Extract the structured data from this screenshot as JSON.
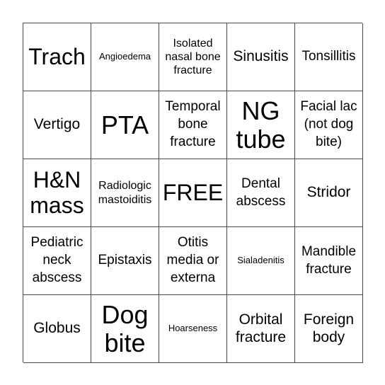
{
  "board": {
    "cells": [
      {
        "text": "Trach",
        "size": "xl"
      },
      {
        "text": "Angioedema",
        "size": "xs"
      },
      {
        "text": "Isolated nasal bone fracture",
        "size": "sm"
      },
      {
        "text": "Sinusitis",
        "size": "lg"
      },
      {
        "text": "Tonsillitis",
        "size": "md"
      },
      {
        "text": "Vertigo",
        "size": "lg"
      },
      {
        "text": "PTA",
        "size": "xxl"
      },
      {
        "text": "Temporal bone fracture",
        "size": "md"
      },
      {
        "text": "NG tube",
        "size": "xxl"
      },
      {
        "text": "Facial lac (not dog bite)",
        "size": "md"
      },
      {
        "text": "H&N mass",
        "size": "xl"
      },
      {
        "text": "Radiologic mastoiditis",
        "size": "sm"
      },
      {
        "text": "FREE",
        "size": "xl"
      },
      {
        "text": "Dental abscess",
        "size": "md"
      },
      {
        "text": "Stridor",
        "size": "lg"
      },
      {
        "text": "Pediatric neck abscess",
        "size": "md"
      },
      {
        "text": "Epistaxis",
        "size": "md"
      },
      {
        "text": "Otitis media or externa",
        "size": "md"
      },
      {
        "text": "Sialadenitis",
        "size": "xs"
      },
      {
        "text": "Mandible fracture",
        "size": "md"
      },
      {
        "text": "Globus",
        "size": "lg"
      },
      {
        "text": "Dog bite",
        "size": "xxl"
      },
      {
        "text": "Hoarseness",
        "size": "xs"
      },
      {
        "text": "Orbital fracture",
        "size": "lg"
      },
      {
        "text": "Foreign body",
        "size": "lg"
      }
    ]
  }
}
